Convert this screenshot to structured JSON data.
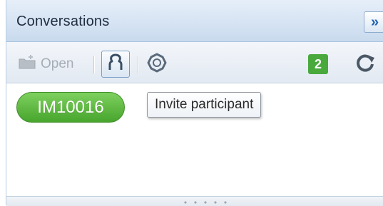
{
  "panel": {
    "title": "Conversations",
    "collapse_icon": "double-chevron-right-icon",
    "collapse_glyph": "»"
  },
  "toolbar": {
    "open_label": "Open",
    "open_icon": "folder-add-icon",
    "invite_icon": "person-add-icon",
    "settings_icon": "gear-icon",
    "refresh_icon": "refresh-icon",
    "conversation_count": "2"
  },
  "tooltip": {
    "text": "Invite participant"
  },
  "conversations": [
    {
      "id": "IM10016"
    }
  ],
  "colors": {
    "header_bg": "#c9daee",
    "badge_green": "#49a93d",
    "accent_blue": "#1f63b4"
  }
}
